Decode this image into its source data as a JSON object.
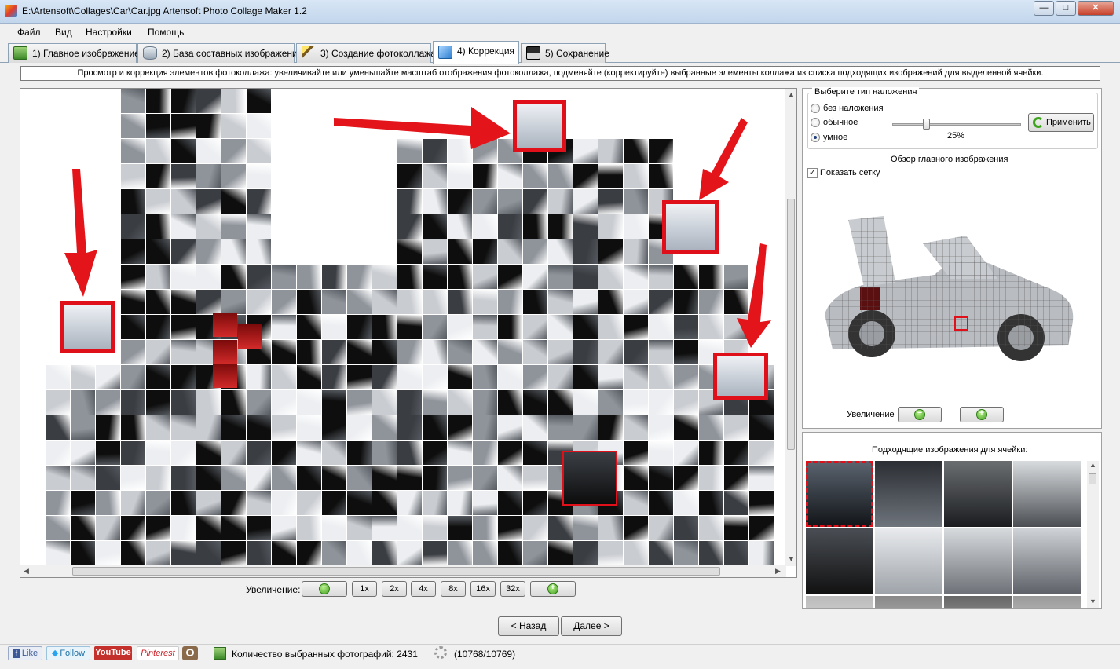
{
  "window": {
    "title": "E:\\Artensoft\\Collages\\Car\\Car.jpg Artensoft Photo Collage Maker 1.2",
    "buttons": {
      "minimize": "—",
      "maximize": "□",
      "close": "✕"
    }
  },
  "menu": [
    "Файл",
    "Вид",
    "Настройки",
    "Помощь"
  ],
  "tabs": [
    {
      "label": "1) Главное изображение",
      "icon": "image-icon"
    },
    {
      "label": "2) База составных изображений",
      "icon": "database-icon"
    },
    {
      "label": "3) Создание фотоколлажа",
      "icon": "magic-wand-icon"
    },
    {
      "label": "4) Коррекция",
      "icon": "cube-icon",
      "active": true
    },
    {
      "label": "5) Сохранение",
      "icon": "floppy-disk-icon"
    }
  ],
  "info": "Просмотр и коррекция элементов фотоколлажа: увеличивайте или уменьшайте масштаб отображения фотоколлажа, подменяйте (корректируйте) выбранные элементы коллажа из списка подходящих изображений для выделенной ячейки.",
  "zoom": {
    "label": "Увеличение:",
    "minus": "−",
    "plus": "+",
    "levels": [
      "1x",
      "2x",
      "4x",
      "8x",
      "16x",
      "32x"
    ]
  },
  "overlay": {
    "title": "Выберите тип наложения",
    "options": [
      "без наложения",
      "обычное",
      "умное"
    ],
    "selected": 2,
    "value_label": "25%",
    "value": 0.25,
    "apply": "Применить"
  },
  "overview": {
    "title": "Обзор главного изображения",
    "show_grid": "Показать сетку",
    "show_grid_checked": true,
    "zoom_label": "Увеличение"
  },
  "suitable": {
    "title": "Подходящие изображения для ячейки:"
  },
  "nav": {
    "back": "< Назад",
    "next": "Далее >"
  },
  "status": {
    "text": "Количество выбранных фотографий: 2431",
    "progress": "(10768/10769)"
  },
  "social": [
    "Like",
    "Follow",
    "YouTube",
    "Pinterest",
    "Instagram"
  ],
  "colors": {
    "highlight": "#e0101a",
    "accent": "#4a7db8"
  }
}
